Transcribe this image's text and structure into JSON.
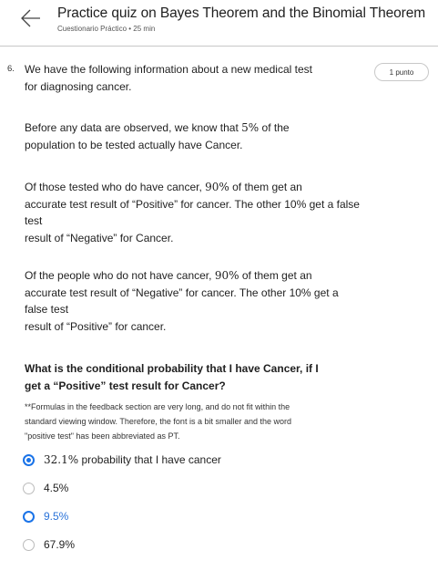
{
  "header": {
    "title": "Practice quiz on Bayes Theorem and the Binomial Theorem",
    "subtitle": "Cuestionario Práctico • 25 min",
    "back_icon": "arrow-left-icon"
  },
  "question": {
    "number": "6.",
    "points": "1 punto",
    "intro": [
      "We have the following information about a new medical test",
      "for diagnosing cancer."
    ],
    "p1": {
      "a": "Before any data are observed, we know that ",
      "m": "5%",
      "b": " of the",
      "line2": "population to be tested actually have Cancer."
    },
    "p2": {
      "a": "Of those tested who do have cancer, ",
      "m": "90%",
      "b": " of them get an",
      "lines": [
        "accurate test result of “Positive” for cancer. The other 10% get a false",
        "test",
        "result of “Negative” for Cancer."
      ]
    },
    "p3": {
      "a": "Of the people who do not have cancer, ",
      "m": "90%",
      "b": " of them get an",
      "lines": [
        "accurate test result of “Negative” for cancer. The other 10% get a",
        "false test",
        "result of “Positive” for cancer."
      ]
    },
    "prompt": [
      "What is the conditional probability that I have Cancer, if I",
      "get a “Positive” test result for Cancer?"
    ],
    "note": [
      "**Formulas in the feedback section are very long, and do not fit within the",
      "standard viewing window. Therefore, the font is a bit smaller and the word",
      "\"positive test\" has been abbreviated as PT."
    ],
    "options": [
      {
        "math": "32.1%",
        "label": " probability that I have cancer",
        "selected": true
      },
      {
        "label": "4.5%",
        "selected": false
      },
      {
        "label": "9.5%",
        "selected": false
      },
      {
        "label": "67.9%",
        "selected": false
      }
    ]
  },
  "colors": {
    "accent": "#1a73e8"
  }
}
